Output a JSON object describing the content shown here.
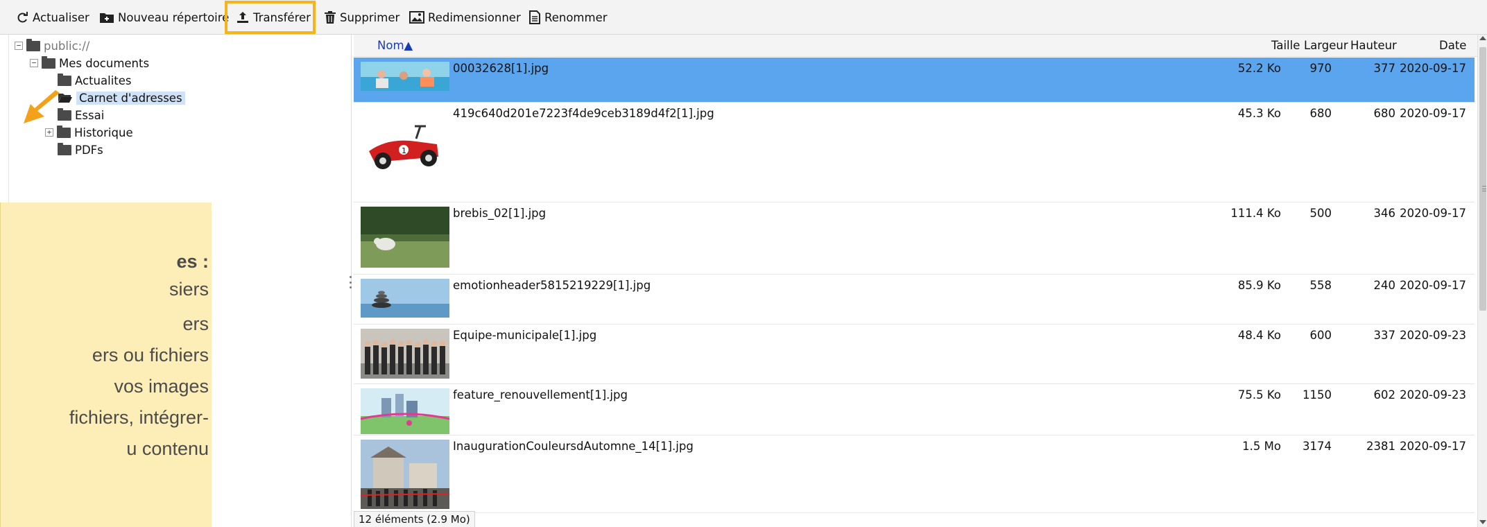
{
  "toolbar": {
    "refresh": "Actualiser",
    "new_folder": "Nouveau répertoire",
    "upload": "Transférer",
    "delete": "Supprimer",
    "resize": "Redimensionner",
    "rename": "Renommer"
  },
  "tree": {
    "root": "public://",
    "my_documents": "Mes documents",
    "items": [
      "Actualites",
      "Carnet d'adresses",
      "Essai",
      "Historique",
      "PDFs"
    ],
    "selected": "Carnet d'adresses"
  },
  "help": {
    "lines": [
      "es :",
      "siers",
      "ers",
      "ers ou fichiers",
      "vos images",
      "fichiers, intégrer-",
      "u contenu"
    ]
  },
  "columns": {
    "name": "Nom",
    "sort_indicator": "▲",
    "size": "Taille",
    "width": "Largeur",
    "height": "Hauteur",
    "date": "Date"
  },
  "files": [
    {
      "name": "00032628[1].jpg",
      "size": "52.2 Ko",
      "width": "970",
      "height": "377",
      "date": "2020-09-17"
    },
    {
      "name": "419c640d201e7223f4de9ceb3189d4f2[1].jpg",
      "size": "45.3 Ko",
      "width": "680",
      "height": "680",
      "date": "2020-09-17"
    },
    {
      "name": "brebis_02[1].jpg",
      "size": "111.4 Ko",
      "width": "500",
      "height": "346",
      "date": "2020-09-17"
    },
    {
      "name": "emotionheader5815219229[1].jpg",
      "size": "85.9 Ko",
      "width": "558",
      "height": "240",
      "date": "2020-09-17"
    },
    {
      "name": "Equipe-municipale[1].jpg",
      "size": "48.4 Ko",
      "width": "600",
      "height": "337",
      "date": "2020-09-23"
    },
    {
      "name": "feature_renouvellement[1].jpg",
      "size": "75.5 Ko",
      "width": "1150",
      "height": "602",
      "date": "2020-09-23"
    },
    {
      "name": "InaugurationCouleursdAutomne_14[1].jpg",
      "size": "1.5 Mo",
      "width": "3174",
      "height": "2381",
      "date": "2020-09-17"
    }
  ],
  "status": "12 éléments (2.9 Mo)",
  "colors": {
    "selected_row": "#5aa5ee",
    "highlight": "#f4b41a",
    "help_bg": "#fdeeb8",
    "sort_header": "#1a3bb5"
  }
}
